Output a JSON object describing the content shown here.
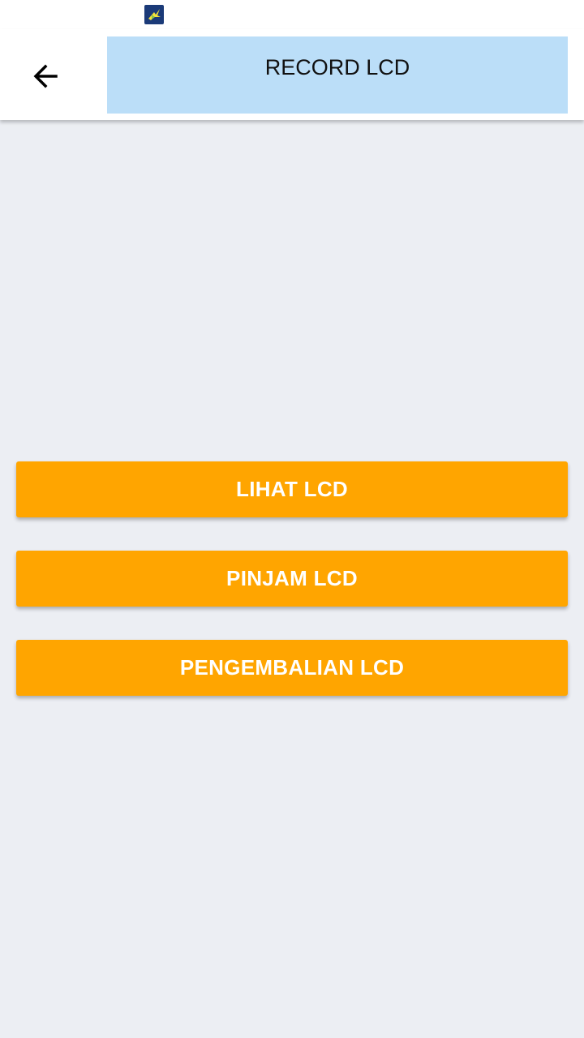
{
  "app_bar": {
    "title": "RECORD LCD",
    "back_icon": "arrow-left-icon"
  },
  "status_bar": {
    "carrier_icon": "xl-carrier-icon"
  },
  "buttons": [
    {
      "label": "LIHAT LCD"
    },
    {
      "label": "PINJAM LCD"
    },
    {
      "label": "PENGEMBALIAN LCD"
    }
  ],
  "colors": {
    "button_bg": "#FFA500",
    "title_bg": "#BBDEF8",
    "page_bg": "#ECEEF3"
  }
}
